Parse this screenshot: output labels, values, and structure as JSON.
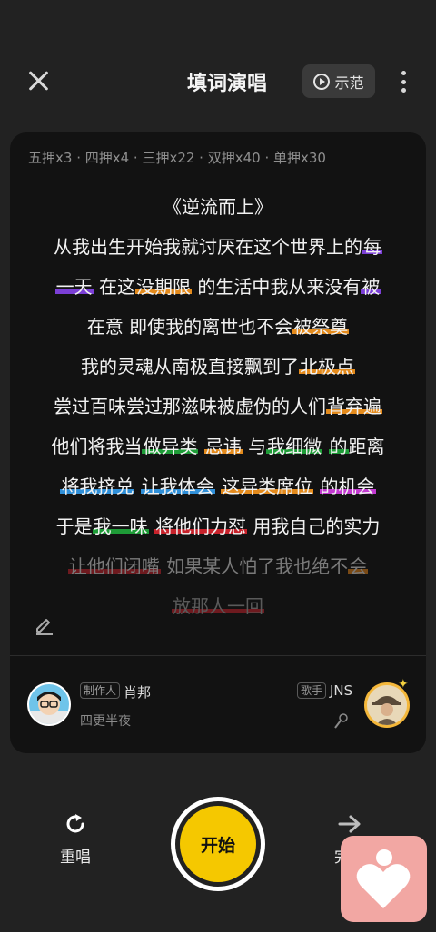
{
  "header": {
    "close_icon": "close-icon",
    "title": "填词演唱",
    "demo_label": "示范",
    "demo_icon": "play-circle-icon",
    "more_icon": "more-vertical-icon"
  },
  "rhyme_stats": "五押x3 · 四押x4 · 三押x22 · 双押x40 · 单押x30",
  "lyrics": {
    "title": "《逆流而上》",
    "lines": [
      {
        "segments": [
          {
            "text": "从我出生开始我就讨厌在这个世界上的"
          },
          {
            "text": "每",
            "hl": "purple"
          }
        ]
      },
      {
        "segments": [
          {
            "text": "一天",
            "hl": "purple"
          },
          {
            "text": " 在这"
          },
          {
            "text": "没期限",
            "hl": "orange"
          },
          {
            "text": " 的生活中我从来没有"
          },
          {
            "text": "被",
            "hl": "purple"
          }
        ]
      },
      {
        "segments": [
          {
            "text": "在意 即使我的离世也不会"
          },
          {
            "text": "被祭奠",
            "hl": "orange"
          }
        ]
      },
      {
        "segments": [
          {
            "text": "我的灵魂从南极直接飘到了"
          },
          {
            "text": "北极点",
            "hl": "orange"
          }
        ]
      },
      {
        "segments": [
          {
            "text": "尝过百味尝过那滋味被虚伪的人们"
          },
          {
            "text": "背弃遍",
            "hl": "orange"
          }
        ]
      },
      {
        "segments": [
          {
            "text": "他们将我当"
          },
          {
            "text": "做异类",
            "hl": "green"
          },
          {
            "text": " "
          },
          {
            "text": "忌讳",
            "hl": "orange"
          },
          {
            "text": " 与"
          },
          {
            "text": "我细微",
            "hl": "green"
          },
          {
            "text": " "
          },
          {
            "text": "的",
            "hl": "green"
          },
          {
            "text": "距离"
          }
        ]
      },
      {
        "segments": [
          {
            "text": "将我挤兑",
            "hl": "blue"
          },
          {
            "text": " "
          },
          {
            "text": "让我体会",
            "hl": "blue"
          },
          {
            "text": " "
          },
          {
            "text": "这异类席位",
            "hl": "orange"
          },
          {
            "text": " "
          },
          {
            "text": "的机会",
            "hl": "magenta"
          }
        ]
      },
      {
        "segments": [
          {
            "text": "于是"
          },
          {
            "text": "我一味",
            "hl": "green"
          },
          {
            "text": " "
          },
          {
            "text": "将他们力怼",
            "hl": "red"
          },
          {
            "text": " 用我自己的实力"
          }
        ]
      },
      {
        "style": "dim",
        "segments": [
          {
            "text": "让他们闭嘴",
            "hl": "red-dim"
          },
          {
            "text": " 如果某人怕了我也绝不"
          },
          {
            "text": "会",
            "hl": "orange-dim"
          }
        ]
      },
      {
        "style": "dimmer",
        "segments": [
          {
            "text": "放那人一回",
            "hl": "red-dim"
          }
        ]
      }
    ]
  },
  "edit_icon": "pencil-icon",
  "producer": {
    "tag": "制作人",
    "name": "肖邦",
    "subtitle": "四更半夜"
  },
  "singer": {
    "tag": "歌手",
    "name": "JNS",
    "mic_icon": "microphone-icon"
  },
  "controls": {
    "replay_label": "重唱",
    "replay_icon": "refresh-icon",
    "start_label": "开始",
    "next_label": "完成",
    "next_icon": "arrow-right-icon"
  },
  "floating_widget_icon": "heart-person-icon"
}
